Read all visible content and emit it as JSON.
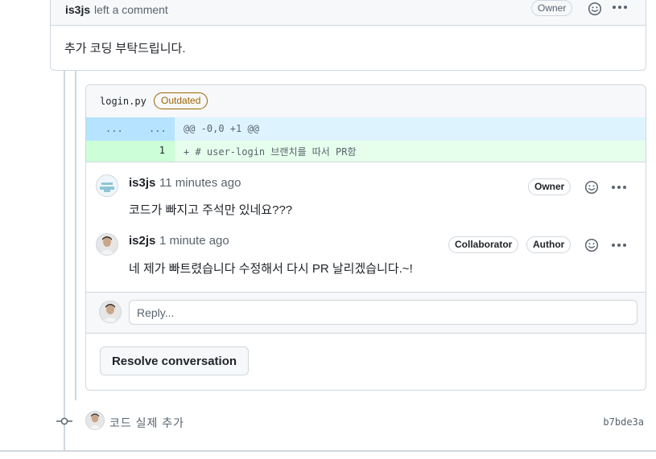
{
  "top_comment": {
    "author": "is3js",
    "action": "left a comment",
    "role_badge": "Owner",
    "body": "추가 코딩 부탁드립니다."
  },
  "thread": {
    "filename": "login.py",
    "outdated_label": "Outdated",
    "hunk": {
      "old_num": "...",
      "new_num": "...",
      "header": "@@ -0,0 +1 @@"
    },
    "added_line": {
      "new_num": "1",
      "code": "+ # user-login 브랜치를 따서 PR함"
    },
    "replies": [
      {
        "author": "is3js",
        "time": "11 minutes ago",
        "badges": [
          "Owner"
        ],
        "body": "코드가 빠지고 주석만 있네요???"
      },
      {
        "author": "is2js",
        "time": "1 minute ago",
        "badges": [
          "Collaborator",
          "Author"
        ],
        "body": "네 제가 빠트렸습니다 수정해서 다시 PR 날리겠습니다.~!"
      }
    ],
    "reply_placeholder": "Reply...",
    "resolve_label": "Resolve conversation"
  },
  "commit": {
    "message": "코드 실제 추가",
    "sha": "b7bde3a"
  },
  "icons": {
    "smiley": "smiley-icon",
    "kebab": "kebab-horizontal-icon",
    "commit": "git-commit-icon"
  },
  "colors": {
    "outdated": "#9a6700",
    "hunk_bg": "#ddf4ff",
    "addition_bg": "#e6ffec"
  }
}
